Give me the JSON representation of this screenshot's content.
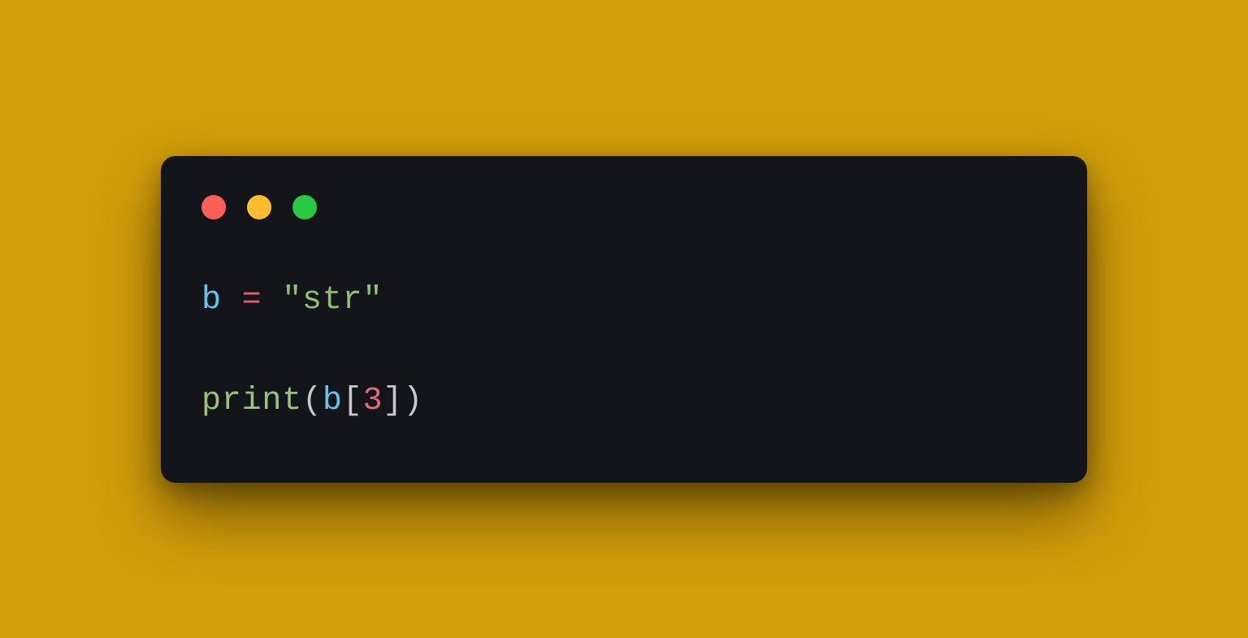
{
  "colors": {
    "background": "#d49e0a",
    "window": "#14151a",
    "close": "#ff5f56",
    "minimize": "#ffbd2e",
    "maximize": "#27c93f"
  },
  "code": {
    "line1": {
      "var": "b",
      "space1": " ",
      "op": "=",
      "space2": " ",
      "str": "\"str\""
    },
    "line2": {
      "fn": "print",
      "lparen": "(",
      "var": "b",
      "lbracket": "[",
      "num": "3",
      "rbracket": "]",
      "rparen": ")"
    }
  }
}
